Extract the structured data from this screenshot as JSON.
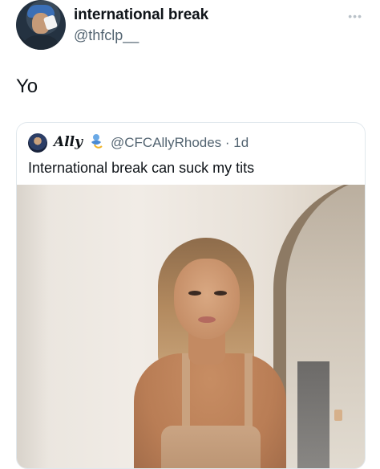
{
  "tweet": {
    "author": {
      "display_name": "international break",
      "handle": "@thfclp__"
    },
    "more_icon": "more-options-icon",
    "text": "Yo",
    "quoted": {
      "author": {
        "display_name": "Ally",
        "emoji_icon": "genie-emoji-icon",
        "handle_time": "@CFCAllyRhodes · 1d"
      },
      "text": "International break can suck my tits"
    }
  },
  "colors": {
    "text_primary": "#0f1419",
    "text_secondary": "#536471",
    "border": "#e1e8ed",
    "background": "#ffffff"
  }
}
